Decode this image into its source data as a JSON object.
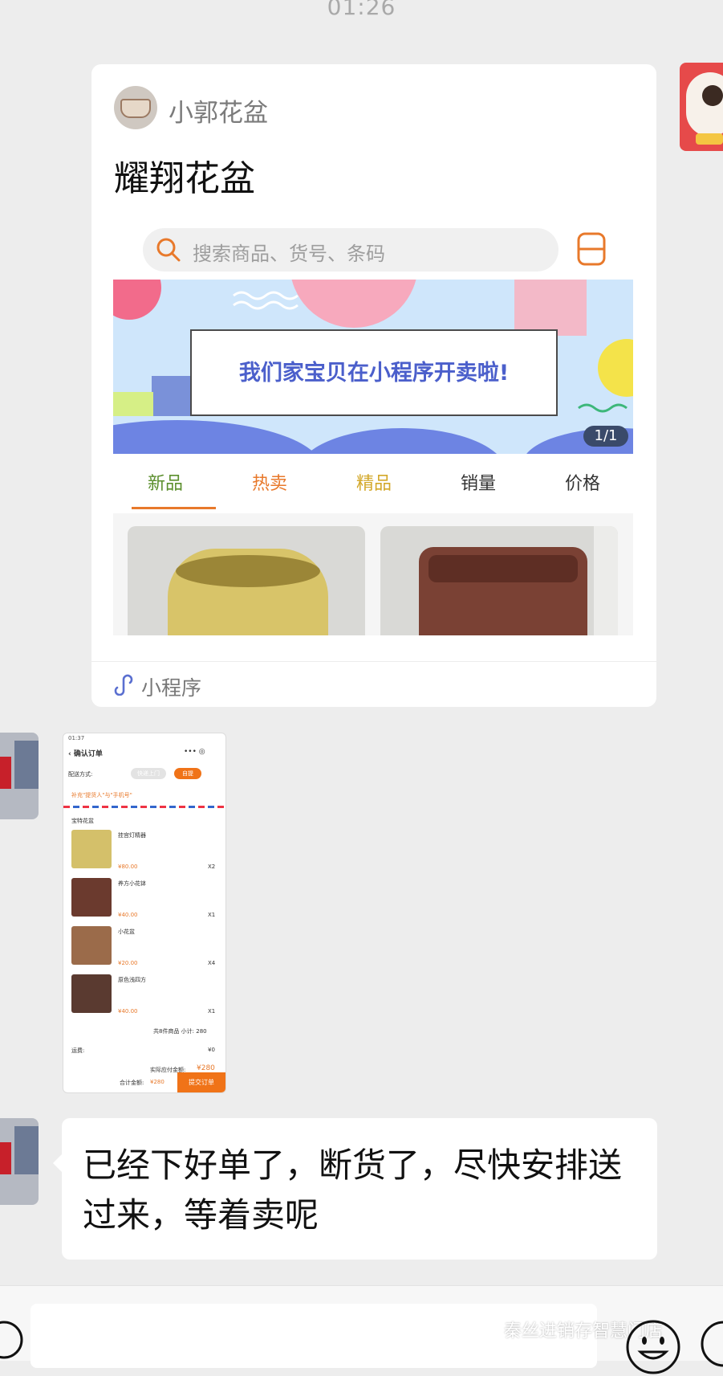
{
  "status_time": "01:26",
  "card": {
    "source_name": "小郭花盆",
    "title": "耀翔花盆",
    "search_placeholder": "搜索商品、货号、条码",
    "banner_text": "我们家宝贝在小程序开卖啦!",
    "banner_counter": "1/1",
    "tabs": [
      {
        "label": "新品",
        "color": "#5b8f2d",
        "active": true
      },
      {
        "label": "热卖",
        "color": "#e8792b"
      },
      {
        "label": "精品",
        "color": "#d3a82a"
      },
      {
        "label": "销量",
        "color": "#333333"
      },
      {
        "label": "价格",
        "color": "#333333"
      }
    ],
    "footer_label": "小程序"
  },
  "thumbnail": {
    "status": "01:37",
    "title": "确认订单",
    "delivery_label": "配送方式:",
    "option_1": "快递上门",
    "option_2": "自提",
    "address_hint": "补充\"提货人\"与\"手机号\"",
    "section_label": "宝特花盆",
    "items": [
      {
        "name": "挂宫灯精器",
        "price": "¥80.00",
        "qty": "X2"
      },
      {
        "name": "养方小花钵",
        "price": "¥40.00",
        "qty": "X1"
      },
      {
        "name": "小花盆",
        "price": "¥20.00",
        "qty": "X4"
      },
      {
        "name": "原色浅四方",
        "price": "¥40.00",
        "qty": "X1"
      }
    ],
    "subtotal": "共8件商品  小计: 280",
    "shipping_label": "运费:",
    "shipping_value": "¥0",
    "paid_label": "实际应付金额:",
    "paid_value": "¥280",
    "total_label": "合计金额:",
    "total_value": "¥280",
    "submit": "提交订单"
  },
  "message_text": "已经下好单了，断货了，尽快安排送过来，等着卖呢",
  "watermark": "秦丝进销存智慧门店",
  "colors": {
    "accent_orange": "#e8792b",
    "chat_bg": "#ededed"
  }
}
